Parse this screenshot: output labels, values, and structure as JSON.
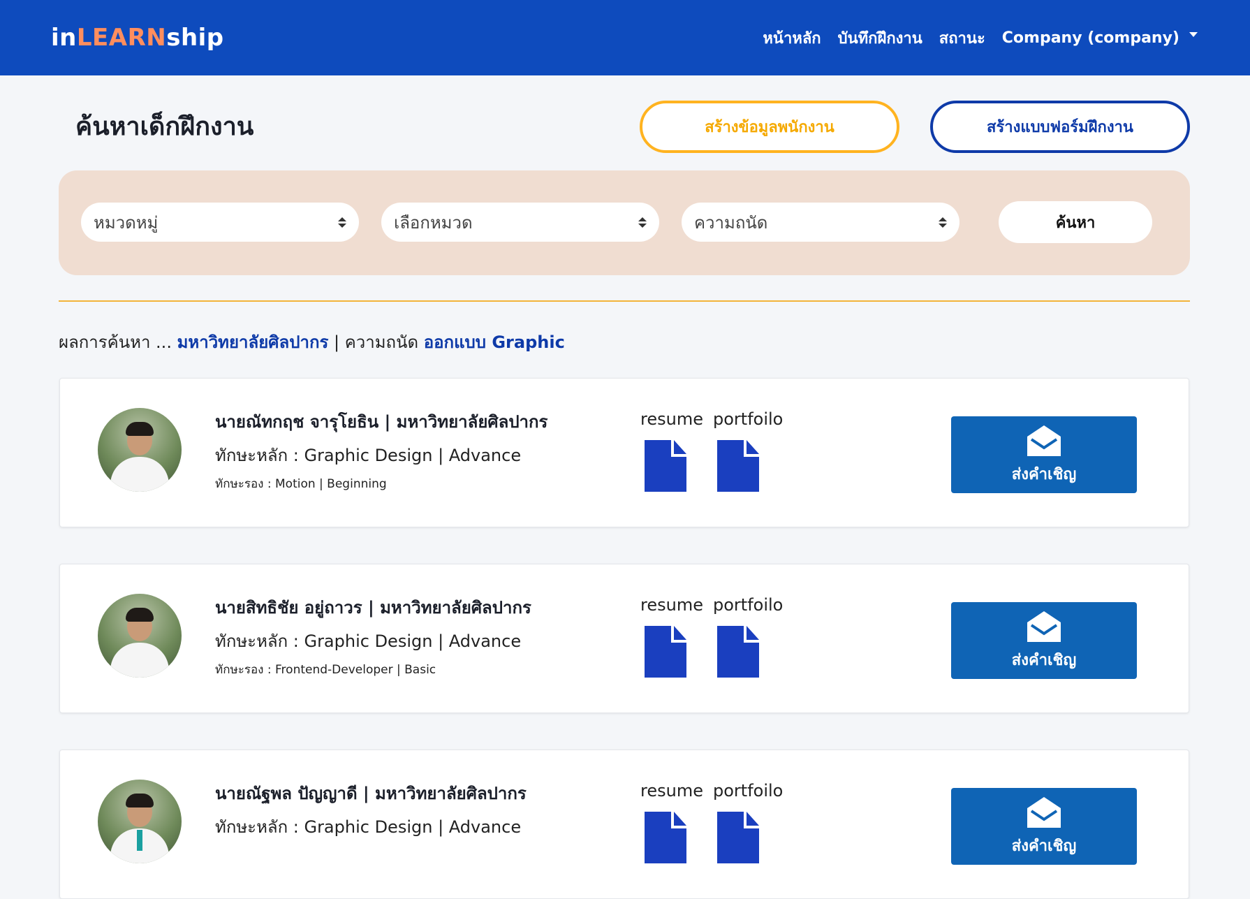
{
  "navbar": {
    "brand": {
      "part1": "in",
      "part2": "LEARN",
      "part3": "ship"
    },
    "links": [
      "หน้าหลัก",
      "บันทึกฝึกงาน",
      "สถานะ",
      "Company (company)"
    ]
  },
  "page": {
    "title": "ค้นหาเด็กฝึกงาน",
    "create_employee_label": "สร้างข้อมูลพนักงาน",
    "create_form_label": "สร้างแบบฟอร์มฝึกงาน"
  },
  "filters": {
    "category": "หมวดหมู่",
    "subcategory": "เลือกหมวด",
    "skill": "ความถนัด",
    "search_label": "ค้นหา"
  },
  "result": {
    "prefix": "ผลการค้นหา ... ",
    "university": "มหาวิทยาลัยศิลปากร",
    "separator": " | ความถนัด ",
    "skill": "ออกแบบ Graphic"
  },
  "candidates": [
    {
      "name": "นายณัทกฤช จารุโยธิน | มหาวิทยาลัยศิลปากร",
      "main_skill": "ทักษะหลัก : Graphic Design | Advance",
      "sub_skill": "ทักษะรอง : Motion | Beginning",
      "resume_label": "resume",
      "portfolio_label": "portfoilo",
      "invite_label": "ส่งคำเชิญ"
    },
    {
      "name": "นายสิทธิชัย อยู่ถาวร | มหาวิทยาลัยศิลปากร",
      "main_skill": "ทักษะหลัก : Graphic Design | Advance",
      "sub_skill": "ทักษะรอง : Frontend-Developer | Basic",
      "resume_label": "resume",
      "portfolio_label": "portfoilo",
      "invite_label": "ส่งคำเชิญ"
    },
    {
      "name": "นายณัฐพล ปัญญาดี | มหาวิทยาลัยศิลปากร",
      "main_skill": "ทักษะหลัก : Graphic Design | Advance",
      "sub_skill": "",
      "resume_label": "resume",
      "portfolio_label": "portfoilo",
      "invite_label": "ส่งคำเชิญ"
    }
  ],
  "colors": {
    "navbar": "#0e4bbd",
    "brand_accent": "#ff8e5e",
    "primary_blue": "#0e3aa8",
    "invite_button": "#0f64b5",
    "yellow": "#ffb320",
    "filter_panel": "#f0ddd1"
  },
  "icons": {
    "document": "file-icon",
    "invite": "envelope-open-icon",
    "dropdown": "caret-down-icon",
    "select": "sort-arrows-icon"
  }
}
